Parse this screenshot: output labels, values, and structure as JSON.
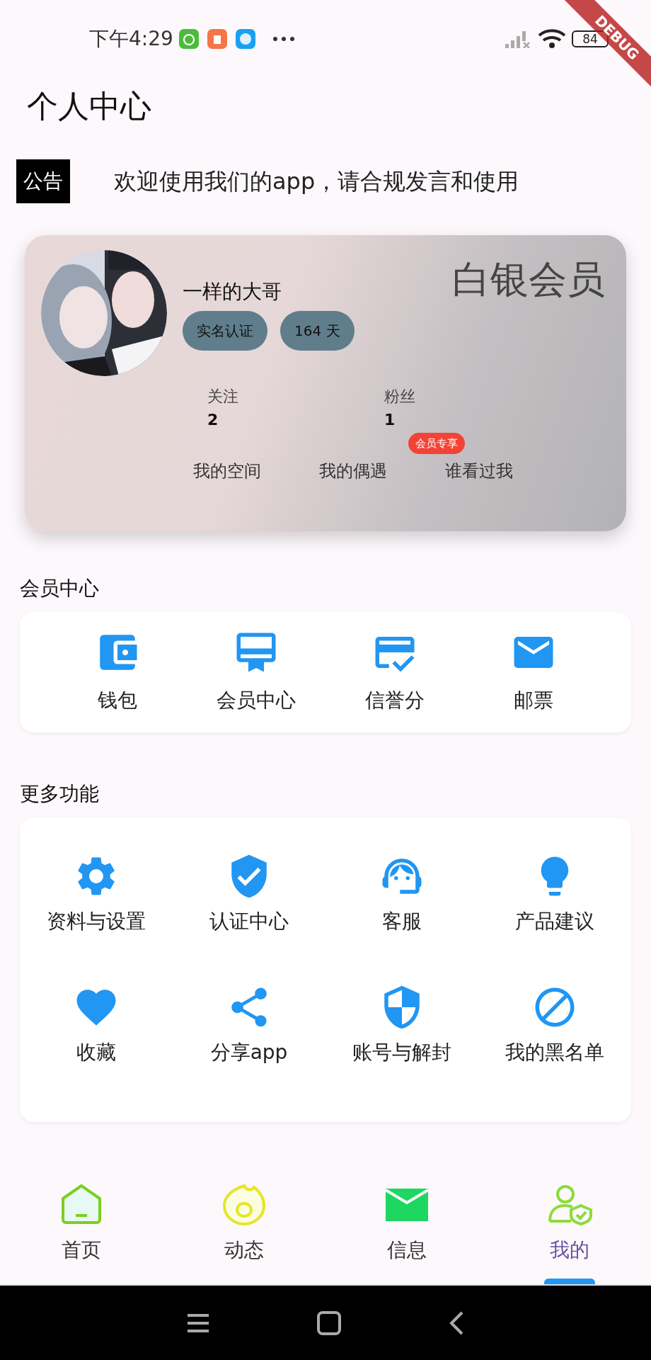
{
  "status_bar": {
    "time": "下午4:29",
    "battery": "84"
  },
  "debug_banner": {
    "label": "DEBUG"
  },
  "header": {
    "title": "个人中心"
  },
  "notice": {
    "tag": "公告",
    "text": "欢迎使用我们的app，请合规发言和使用"
  },
  "profile": {
    "name": "一样的大哥",
    "level": "白银会员",
    "chips": [
      "实名认证",
      "164 天"
    ],
    "stats": [
      {
        "label": "关注",
        "value": "2"
      },
      {
        "label": "粉丝",
        "value": "1"
      }
    ],
    "links": [
      {
        "label": "我的空间"
      },
      {
        "label": "我的偶遇"
      },
      {
        "label": "谁看过我",
        "badge": "会员专享"
      }
    ]
  },
  "member_section": {
    "title": "会员中心",
    "items": [
      "钱包",
      "会员中心",
      "信誉分",
      "邮票"
    ]
  },
  "more_section": {
    "title": "更多功能",
    "items": [
      "资料与设置",
      "认证中心",
      "客服",
      "产品建议",
      "收藏",
      "分享app",
      "账号与解封",
      "我的黑名单"
    ]
  },
  "bottom_nav": [
    {
      "label": "首页",
      "selected": false
    },
    {
      "label": "动态",
      "selected": false
    },
    {
      "label": "信息",
      "selected": false
    },
    {
      "label": "我的",
      "selected": true
    }
  ]
}
